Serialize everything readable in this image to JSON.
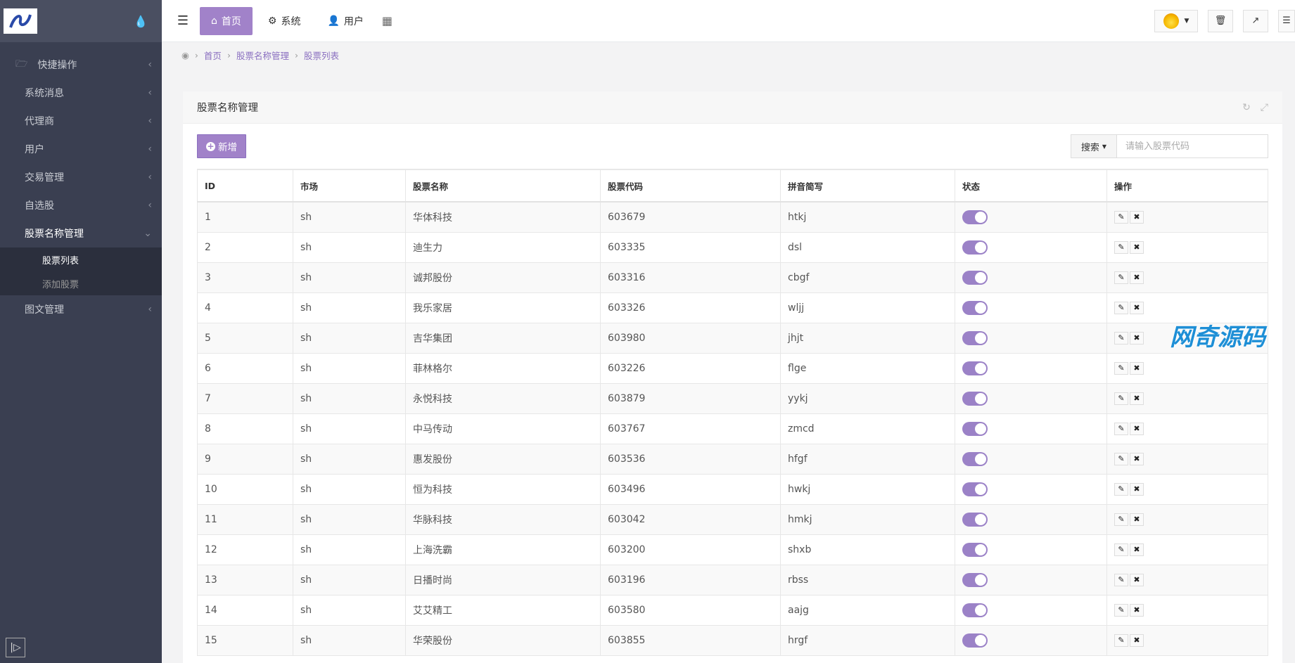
{
  "sidebar": {
    "items": [
      {
        "label": "快捷操作"
      },
      {
        "label": "系统消息"
      },
      {
        "label": "代理商"
      },
      {
        "label": "用户"
      },
      {
        "label": "交易管理"
      },
      {
        "label": "自选股"
      },
      {
        "label": "股票名称管理"
      },
      {
        "label": "图文管理"
      }
    ],
    "submenu": [
      {
        "label": "股票列表"
      },
      {
        "label": "添加股票"
      }
    ]
  },
  "topbar": {
    "tabs": [
      {
        "label": "首页"
      },
      {
        "label": "系统"
      },
      {
        "label": "用户"
      }
    ]
  },
  "breadcrumb": {
    "home": "首页",
    "section": "股票名称管理",
    "page": "股票列表"
  },
  "panel": {
    "title": "股票名称管理",
    "add_label": "新增",
    "search_label": "搜索",
    "search_placeholder": "请输入股票代码"
  },
  "table": {
    "headers": [
      "ID",
      "市场",
      "股票名称",
      "股票代码",
      "拼音简写",
      "状态",
      "操作"
    ],
    "rows": [
      [
        "1",
        "sh",
        "华体科技",
        "603679",
        "htkj"
      ],
      [
        "2",
        "sh",
        "迪生力",
        "603335",
        "dsl"
      ],
      [
        "3",
        "sh",
        "诚邦股份",
        "603316",
        "cbgf"
      ],
      [
        "4",
        "sh",
        "我乐家居",
        "603326",
        "wljj"
      ],
      [
        "5",
        "sh",
        "吉华集团",
        "603980",
        "jhjt"
      ],
      [
        "6",
        "sh",
        "菲林格尔",
        "603226",
        "flge"
      ],
      [
        "7",
        "sh",
        "永悦科技",
        "603879",
        "yykj"
      ],
      [
        "8",
        "sh",
        "中马传动",
        "603767",
        "zmcd"
      ],
      [
        "9",
        "sh",
        "惠发股份",
        "603536",
        "hfgf"
      ],
      [
        "10",
        "sh",
        "恒为科技",
        "603496",
        "hwkj"
      ],
      [
        "11",
        "sh",
        "华脉科技",
        "603042",
        "hmkj"
      ],
      [
        "12",
        "sh",
        "上海洗霸",
        "603200",
        "shxb"
      ],
      [
        "13",
        "sh",
        "日播时尚",
        "603196",
        "rbss"
      ],
      [
        "14",
        "sh",
        "艾艾精工",
        "603580",
        "aajg"
      ],
      [
        "15",
        "sh",
        "华荣股份",
        "603855",
        "hrgf"
      ]
    ]
  },
  "watermark": "网奇源码",
  "colors": {
    "accent": "#a182c9",
    "sidebar": "#3a3f51"
  }
}
